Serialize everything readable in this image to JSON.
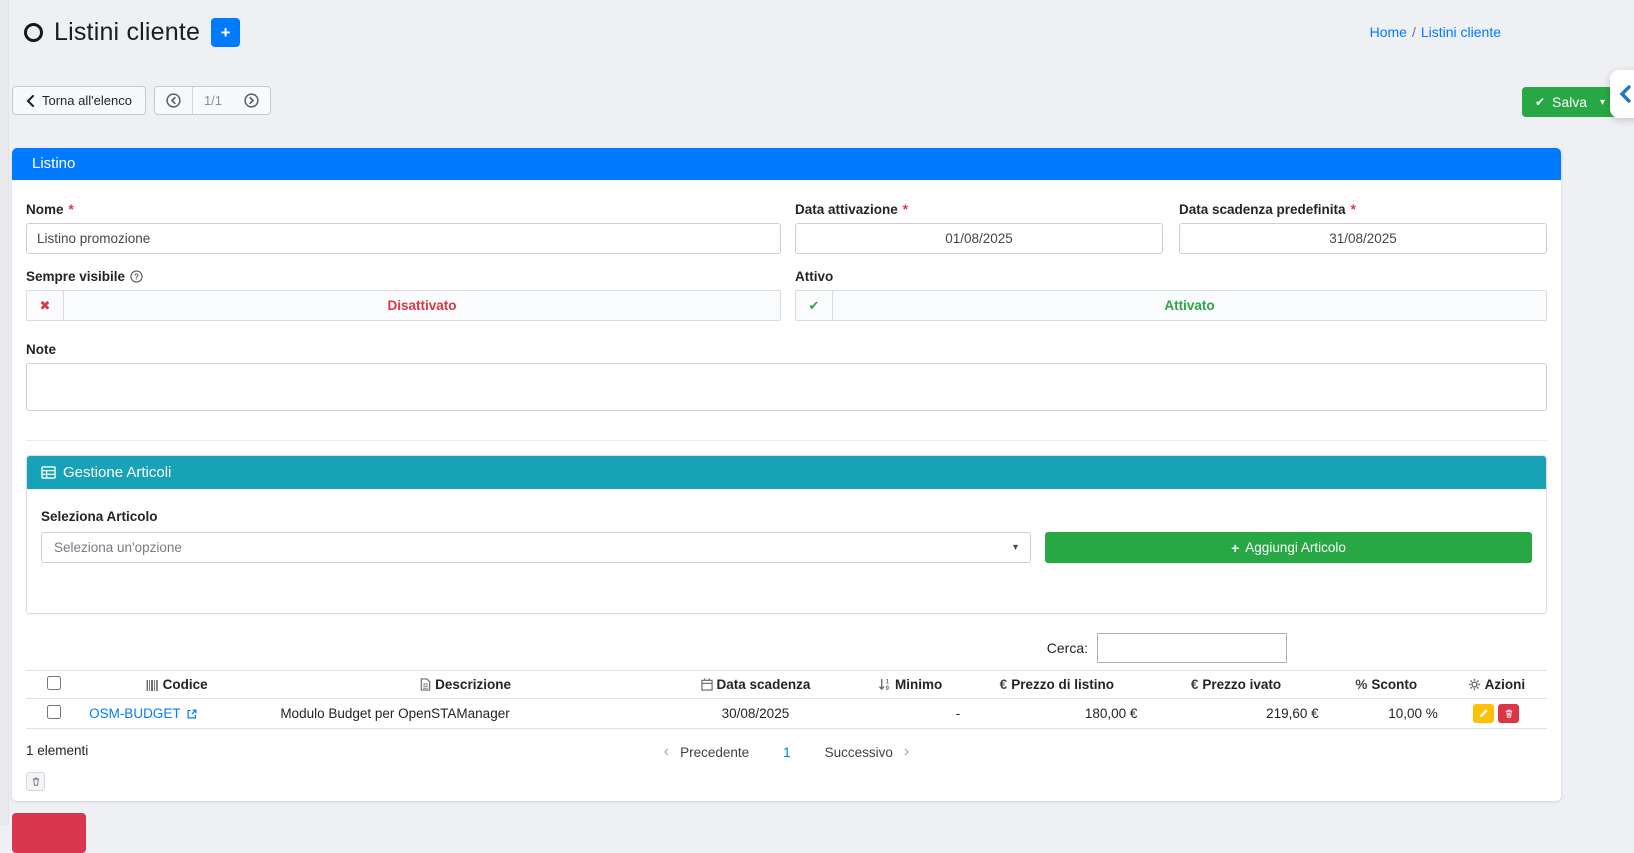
{
  "page": {
    "title": "Listini cliente"
  },
  "breadcrumb": {
    "home": "Home",
    "separator": "/",
    "current": "Listini cliente"
  },
  "toolbar": {
    "back": "Torna all'elenco",
    "page_indicator": "1/1",
    "save": "Salva"
  },
  "listino": {
    "header": "Listino",
    "required_mark": "*",
    "nome_label": "Nome",
    "nome_value": "Listino promozione",
    "attivazione_label": "Data attivazione",
    "attivazione_value": "01/08/2025",
    "scadenza_label": "Data scadenza predefinita",
    "scadenza_value": "31/08/2025",
    "sempre_visibile_label": "Sempre visibile",
    "sempre_visibile_state": "Disattivato",
    "attivo_label": "Attivo",
    "attivo_state": "Attivato",
    "note_label": "Note",
    "note_value": ""
  },
  "articoli": {
    "header": "Gestione Articoli",
    "select_label": "Seleziona Articolo",
    "select_placeholder": "Seleziona un'opzione",
    "add_button": "Aggiungi Articolo"
  },
  "table": {
    "search_label": "Cerca:",
    "search_value": "",
    "col_codice": "Codice",
    "col_descrizione": "Descrizione",
    "col_data_scadenza": "Data scadenza",
    "col_minimo": "Minimo",
    "col_prezzo_listino": "Prezzo di listino",
    "col_prezzo_ivato": "Prezzo ivato",
    "col_sconto": "Sconto",
    "col_azioni": "Azioni",
    "rows": [
      {
        "codice": "OSM-BUDGET",
        "descrizione": "Modulo Budget per OpenSTAManager",
        "data_scadenza": "30/08/2025",
        "minimo": "-",
        "prezzo_listino": "180,00 €",
        "prezzo_ivato": "219,60 €",
        "sconto": "10,00 %"
      }
    ],
    "count": "1 elementi",
    "prev_label": "Precedente",
    "current_page": "1",
    "next_label": "Successivo"
  },
  "colors": {
    "primary": "#007bff",
    "info": "#17a2b8",
    "success": "#28a745",
    "danger": "#dc3545",
    "warning": "#ffc107"
  }
}
